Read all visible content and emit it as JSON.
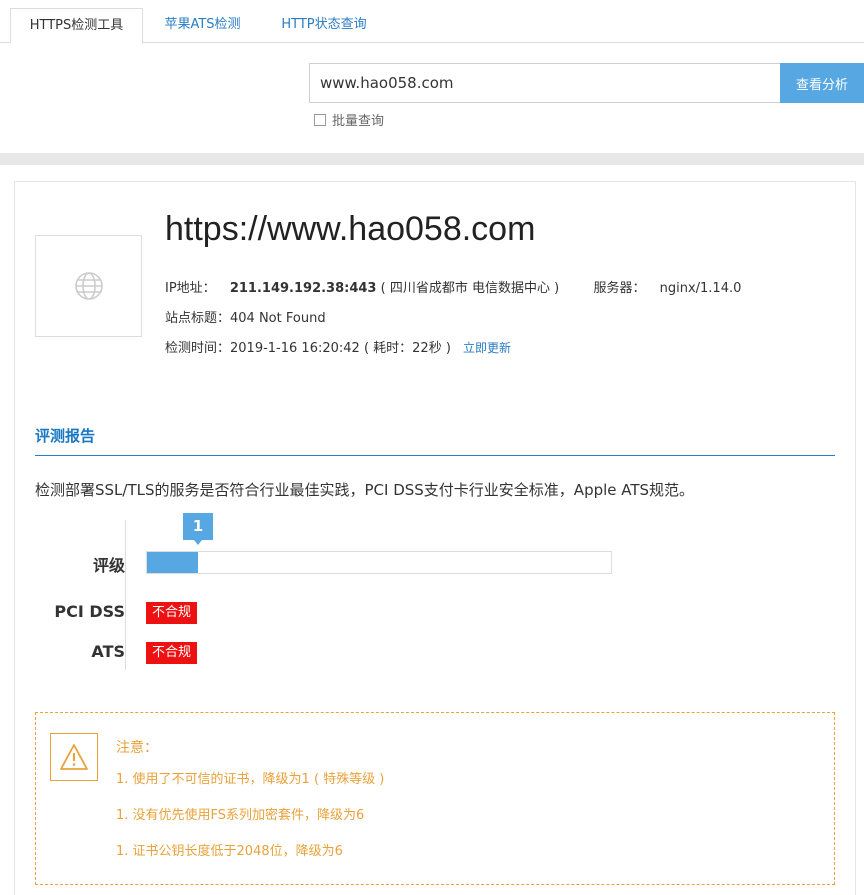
{
  "tabs": [
    {
      "label": "HTTPS检测工具",
      "active": true
    },
    {
      "label": "苹果ATS检测",
      "active": false
    },
    {
      "label": "HTTP状态查询",
      "active": false
    }
  ],
  "search": {
    "value": "www.hao058.com",
    "button_label": "查看分析",
    "batch_label": "批量查询"
  },
  "site": {
    "url": "https://www.hao058.com",
    "ip_label": "IP地址：",
    "ip_value": "211.149.192.38:443",
    "ip_location": "( 四川省成都市 电信数据中心 )",
    "server_label": "服务器：",
    "server_value": "nginx/1.14.0",
    "title_label": "站点标题：",
    "title_value": "404 Not Found",
    "time_label": "检测时间：",
    "time_value": "2019-1-16 16:20:42",
    "duration": "( 耗时：22秒 )",
    "refresh_link": "立即更新"
  },
  "report": {
    "section_title": "评测报告",
    "description": "检测部署SSL/TLS的服务是否符合行业最佳实践，PCI DSS支付卡行业安全标准，Apple ATS规范。",
    "grade_label": "评级",
    "grade_value": "1",
    "grade_fill_percent": 11,
    "pci_label": "PCI DSS",
    "pci_status": "不合规",
    "ats_label": "ATS",
    "ats_status": "不合规"
  },
  "notice": {
    "title": "注意：",
    "items": [
      "1. 使用了不可信的证书，降级为1 ( 特殊等级 )",
      "1. 没有优先使用FS系列加密套件，降级为6",
      "1. 证书公钥长度低于2048位，降级为6"
    ]
  },
  "colors": {
    "accent": "#57a7e3",
    "link": "#2a7dc4",
    "fail": "#ee1111",
    "warning": "#e9a23b"
  }
}
